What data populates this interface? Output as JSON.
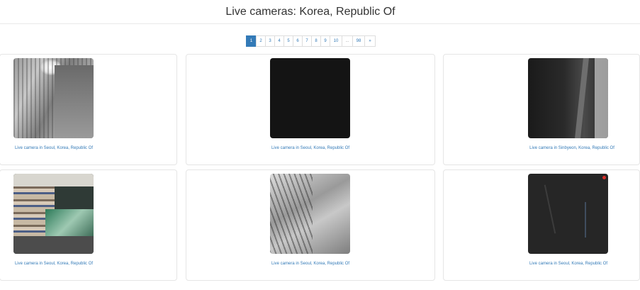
{
  "page": {
    "title": "Live cameras: Korea, Republic Of"
  },
  "pagination": {
    "pages": [
      "1",
      "2",
      "3",
      "4",
      "5",
      "6",
      "7",
      "8",
      "9",
      "10",
      "...",
      "98",
      "»"
    ],
    "active": "1"
  },
  "cameras": [
    {
      "caption": "Live camera in Seoul, Korea, Republic Of"
    },
    {
      "caption": "Live camera in Seoul, Korea, Republic Of"
    },
    {
      "caption": "Live camera in Sinbyeon, Korea, Republic Of"
    },
    {
      "caption": "Live camera in Seoul, Korea, Republic Of"
    },
    {
      "caption": "Live camera in Seoul, Korea, Republic Of"
    },
    {
      "caption": "Live camera in Seoul, Korea, Republic Of"
    }
  ],
  "colors": {
    "link": "#337ab7",
    "active_page_bg": "#337ab7",
    "recording_dot": "#d9302b"
  }
}
